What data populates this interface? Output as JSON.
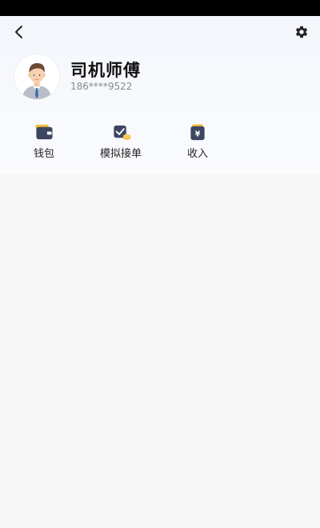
{
  "profile": {
    "name": "司机师傅",
    "phone": "186****9522"
  },
  "header": {
    "back_icon": "chevron-left-icon",
    "settings_icon": "gear-icon"
  },
  "menu": {
    "items": [
      {
        "label": "钱包",
        "icon": "wallet-icon"
      },
      {
        "label": "模拟接单",
        "icon": "checkbox-coin-icon"
      },
      {
        "label": "收入",
        "icon": "yen-card-icon"
      }
    ]
  },
  "colors": {
    "status_bar": "#000000",
    "header_bg": "#f3f6fb",
    "page_bg": "#f6f6f6",
    "icon_dark": "#3d4660",
    "icon_accent": "#f5b93a"
  }
}
